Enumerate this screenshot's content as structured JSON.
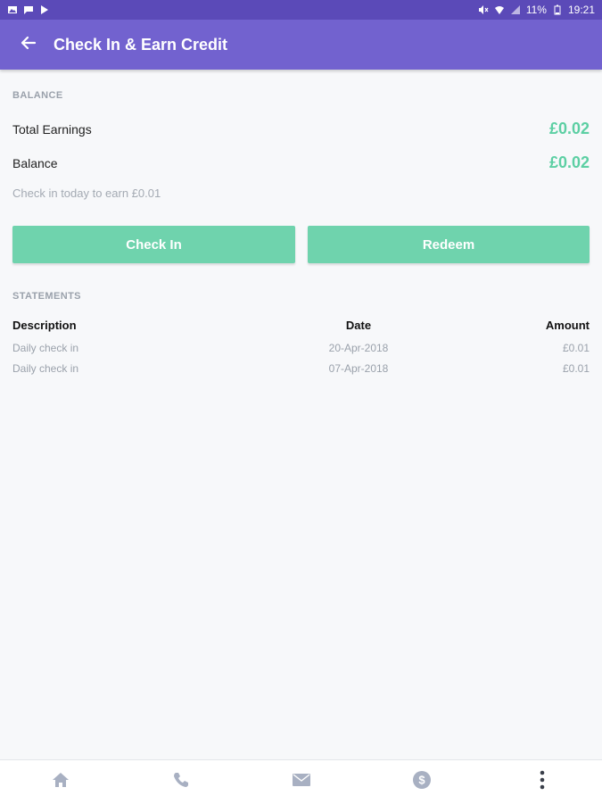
{
  "status_bar": {
    "battery": "11%",
    "time": "19:21"
  },
  "app_bar": {
    "title": "Check In & Earn Credit"
  },
  "balance": {
    "section_label": "BALANCE",
    "total_earnings_label": "Total Earnings",
    "total_earnings_value": "£0.02",
    "balance_label": "Balance",
    "balance_value": "£0.02",
    "hint": "Check in today to earn £0.01",
    "value_color": "#5ccfa3"
  },
  "actions": {
    "check_in_label": "Check In",
    "redeem_label": "Redeem",
    "button_color": "#6fd3ad"
  },
  "statements": {
    "section_label": "STATEMENTS",
    "columns": [
      "Description",
      "Date",
      "Amount"
    ],
    "rows": [
      {
        "description": "Daily check in",
        "date": "20-Apr-2018",
        "amount": "£0.01"
      },
      {
        "description": "Daily check in",
        "date": "07-Apr-2018",
        "amount": "£0.01"
      }
    ]
  },
  "bottom_nav": {
    "items": [
      "home-icon",
      "phone-icon",
      "mail-icon",
      "dollar-icon",
      "more-vert-icon"
    ]
  },
  "colors": {
    "app_bar": "#7262cf",
    "status_bar": "#5b4ab8",
    "accent": "#6fd3ad"
  }
}
